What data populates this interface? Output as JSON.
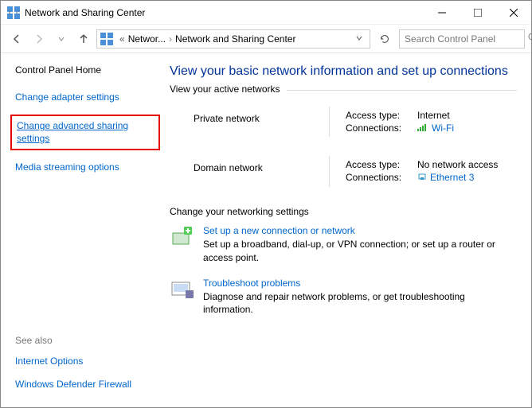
{
  "window": {
    "title": "Network and Sharing Center"
  },
  "breadcrumb": {
    "item1": "Networ...",
    "item2": "Network and Sharing Center"
  },
  "search": {
    "placeholder": "Search Control Panel"
  },
  "sidebar": {
    "home": "Control Panel Home",
    "adapter": "Change adapter settings",
    "advanced": "Change advanced sharing settings",
    "media": "Media streaming options",
    "seealso": "See also",
    "internet": "Internet Options",
    "firewall": "Windows Defender Firewall"
  },
  "main": {
    "heading": "View your basic network information and set up connections",
    "activeLegend": "View your active networks",
    "net1": {
      "name": "Private network",
      "accessLabel": "Access type:",
      "accessValue": "Internet",
      "connLabel": "Connections:",
      "connValue": "Wi-Fi"
    },
    "net2": {
      "name": "Domain network",
      "accessLabel": "Access type:",
      "accessValue": "No network access",
      "connLabel": "Connections:",
      "connValue": "Ethernet 3"
    },
    "changeLegend": "Change your networking settings",
    "task1": {
      "title": "Set up a new connection or network",
      "desc": "Set up a broadband, dial-up, or VPN connection; or set up a router or access point."
    },
    "task2": {
      "title": "Troubleshoot problems",
      "desc": "Diagnose and repair network problems, or get troubleshooting information."
    }
  }
}
